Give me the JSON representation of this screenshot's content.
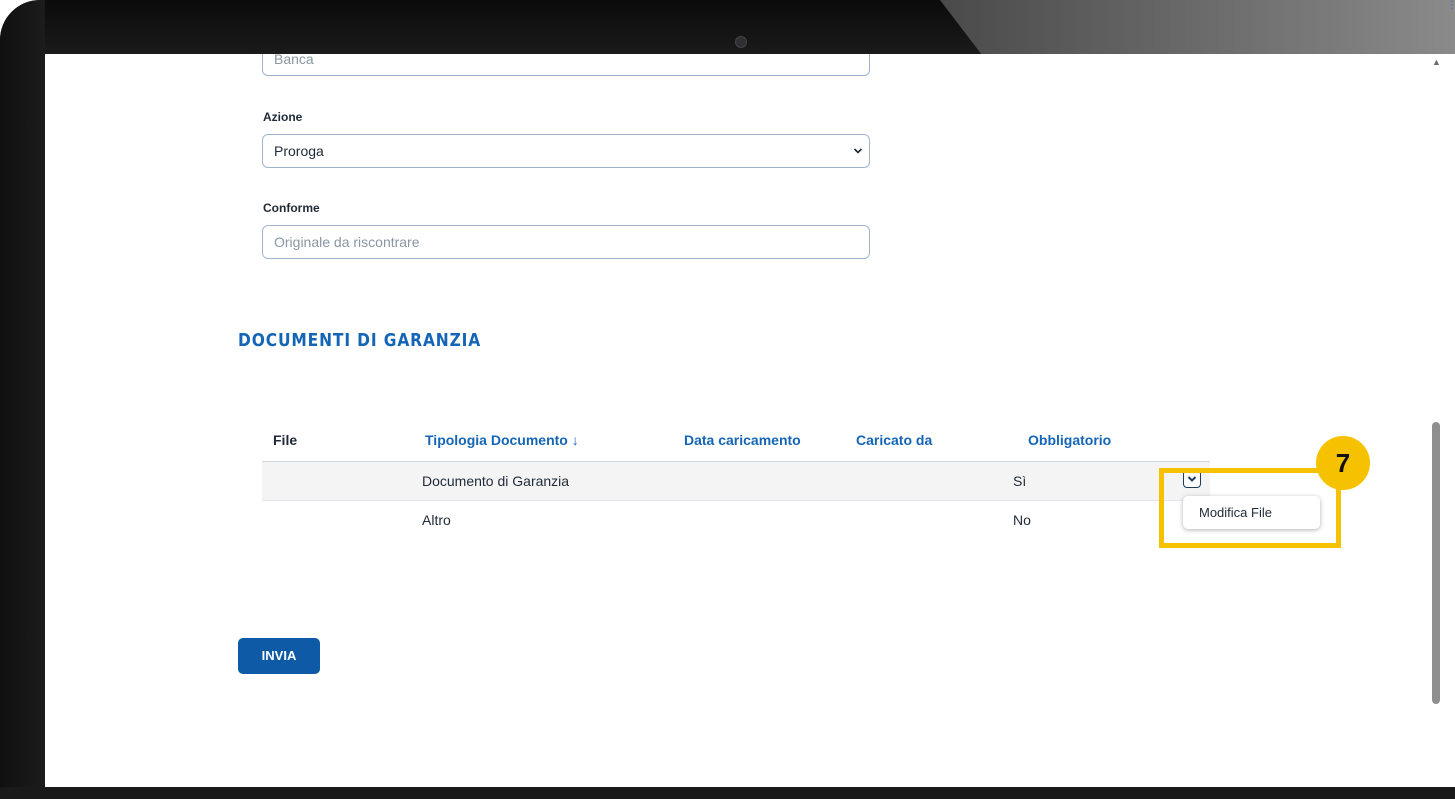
{
  "form": {
    "bank_placeholder": "Banca",
    "action_label": "Azione",
    "action_value": "Proroga",
    "compliant_label": "Conforme",
    "compliant_placeholder": "Originale da riscontrare"
  },
  "section": {
    "title": "DOCUMENTI DI GARANZIA"
  },
  "table": {
    "headers": [
      "File",
      "Tipologia Documento",
      "Data caricamento",
      "Caricato da",
      "Obbligatorio"
    ],
    "sort_indicator": "↓",
    "rows": [
      {
        "file": "",
        "type": "Documento di Garanzia",
        "upload_date": "",
        "uploaded_by": "",
        "mandatory": "Sì"
      },
      {
        "file": "",
        "type": "Altro",
        "upload_date": "",
        "uploaded_by": "",
        "mandatory": "No"
      }
    ]
  },
  "row_menu": {
    "items": [
      "Modifica File"
    ]
  },
  "annotation": {
    "step": "7",
    "color": "#f6c200"
  },
  "actions": {
    "submit_label": "INVIA"
  },
  "icons": {
    "select": "chevron-down-icon",
    "sort": "arrow-down-icon",
    "row_toggle": "chevron-down-icon"
  },
  "colors": {
    "accent": "#1565b6",
    "button": "#0f5aa6"
  }
}
